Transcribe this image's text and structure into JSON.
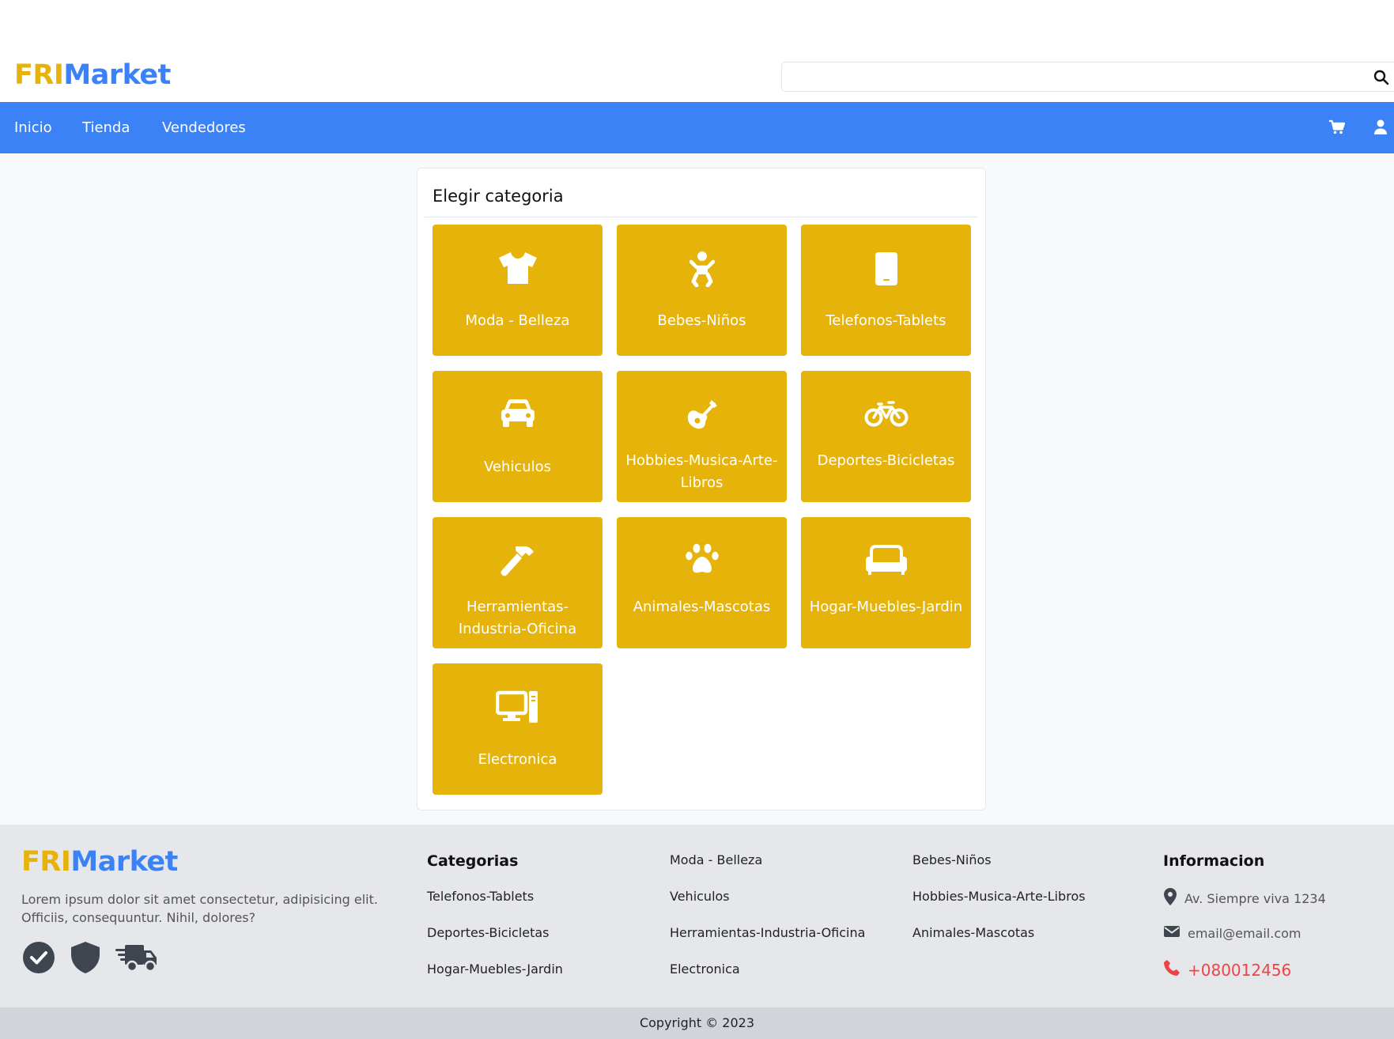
{
  "brand": {
    "part1": "FRI",
    "part2": "Market",
    "color1": "#e7b30a",
    "color2": "#3b82f6"
  },
  "search": {
    "placeholder": "",
    "value": "",
    "icon": "search-icon"
  },
  "nav": {
    "links": [
      "Inicio",
      "Tienda",
      "Vendedores"
    ],
    "icons": [
      "cart-icon",
      "user-icon"
    ],
    "background": "#3b82f6"
  },
  "main": {
    "title": "Elegir categoria",
    "tile_color": "#e6b30b",
    "categories": [
      {
        "label": "Moda - Belleza",
        "icon": "shirt-icon"
      },
      {
        "label": "Bebes-Niños",
        "icon": "baby-icon"
      },
      {
        "label": "Telefonos-Tablets",
        "icon": "phone-icon"
      },
      {
        "label": "Vehiculos",
        "icon": "car-icon"
      },
      {
        "label": "Hobbies-Musica-Arte-Libros",
        "icon": "guitar-icon"
      },
      {
        "label": "Deportes-Bicicletas",
        "icon": "bicycle-icon"
      },
      {
        "label": "Herramientas-Industria-Oficina",
        "icon": "hammer-icon"
      },
      {
        "label": "Animales-Mascotas",
        "icon": "paw-icon"
      },
      {
        "label": "Hogar-Muebles-Jardin",
        "icon": "couch-icon"
      },
      {
        "label": "Electronica",
        "icon": "computer-icon"
      }
    ]
  },
  "footer": {
    "description": "Lorem ipsum dolor sit amet consectetur, adipisicing elit. Officiis, consequuntur. Nihil, dolores?",
    "badges": [
      "check-circle-icon",
      "shield-icon",
      "truck-icon"
    ],
    "categories_heading": "Categorias",
    "category_links": [
      "Telefonos-Tablets",
      "Deportes-Bicicletas",
      "Hogar-Muebles-Jardin",
      "Moda - Belleza",
      "Vehiculos",
      "Herramientas-Industria-Oficina",
      "Electronica",
      "Bebes-Niños",
      "Hobbies-Musica-Arte-Libros",
      "Animales-Mascotas"
    ],
    "info_heading": "Informacion",
    "address": "Av. Siempre viva 1234",
    "email": "email@email.com",
    "phone": "+080012456",
    "phone_color": "#ef4444"
  },
  "copyright": "Copyright © 2023"
}
